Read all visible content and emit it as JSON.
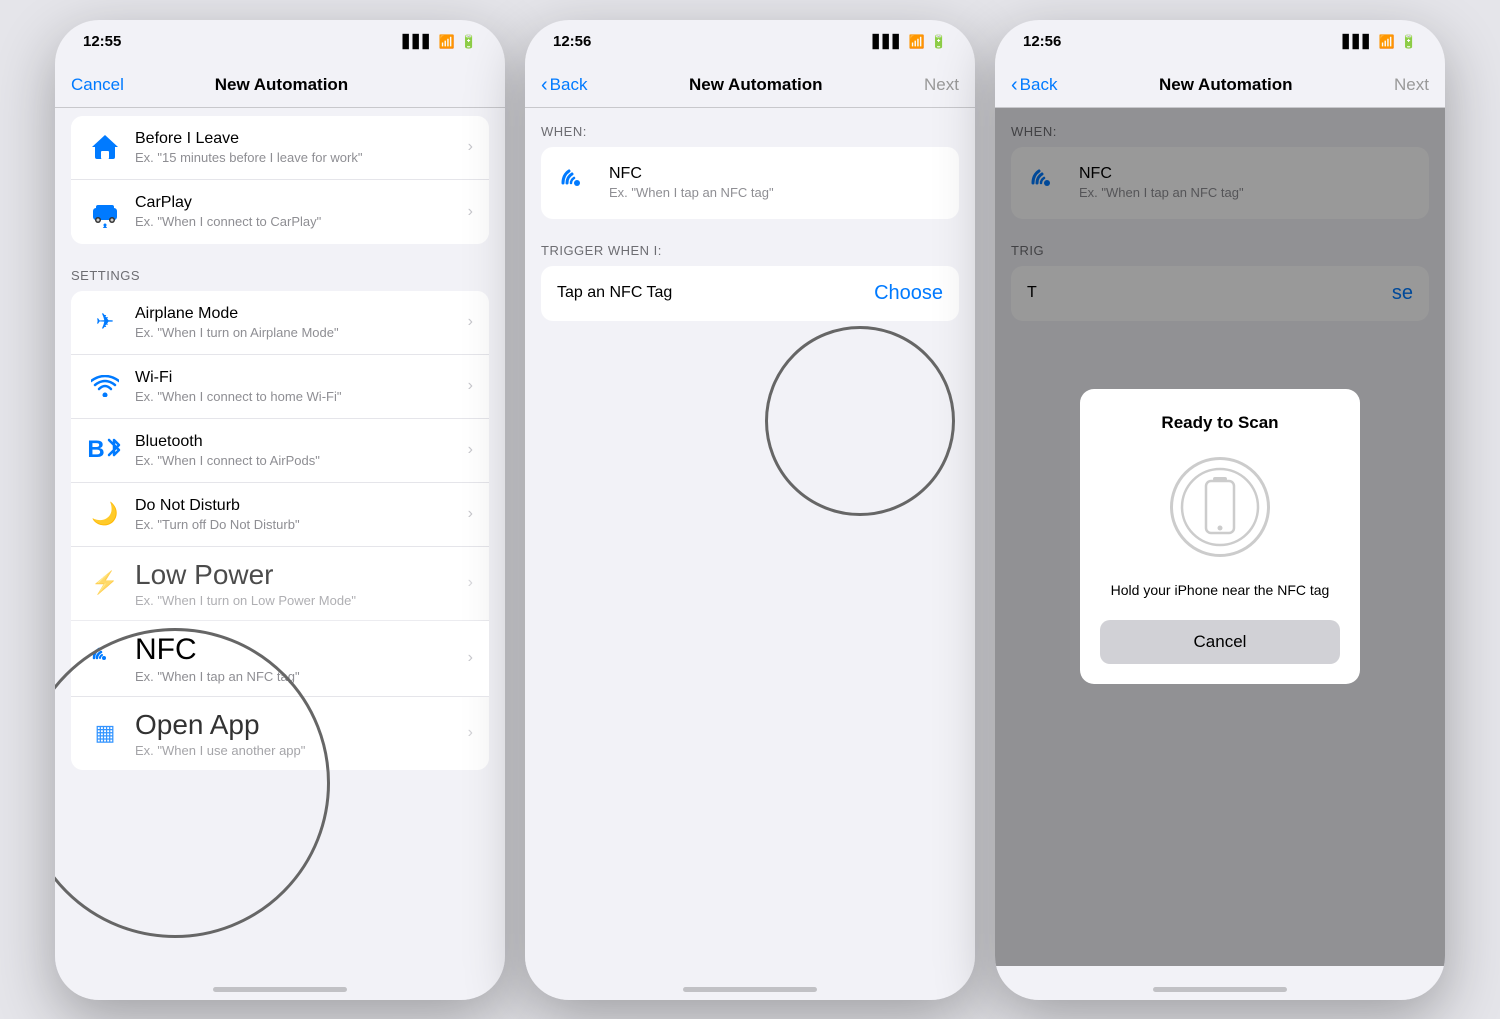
{
  "phone1": {
    "statusTime": "12:55",
    "navCancelLabel": "Cancel",
    "navTitleLabel": "New Automation",
    "items": [
      {
        "icon": "house",
        "title": "Before I Leave",
        "subtitle": "Ex. \"15 minutes before I leave for work\"",
        "category": "location"
      },
      {
        "icon": "car",
        "title": "CarPlay",
        "subtitle": "Ex. \"When I connect to CarPlay\"",
        "category": "carplay"
      }
    ],
    "settingsHeader": "SETTINGS",
    "settingsItems": [
      {
        "icon": "airplane",
        "title": "Airplane Mode",
        "subtitle": "Ex. \"When I turn on Airplane Mode\""
      },
      {
        "icon": "wifi",
        "title": "Wi-Fi",
        "subtitle": "Ex. \"When I connect to home Wi-Fi\""
      },
      {
        "icon": "bluetooth",
        "title": "Bluetooth",
        "subtitle": "Ex. \"When I connect to AirPods\""
      },
      {
        "icon": "moon",
        "title": "Do Not Disturb",
        "subtitle": "Ex. \"Turn off Do Not Disturb\""
      },
      {
        "icon": "lightning",
        "title": "Low Power",
        "subtitle": "Ex. \"When I turn on Low Power Mode\""
      },
      {
        "icon": "nfc",
        "title": "NFC",
        "subtitle": "Ex. \"When I tap an NFC tag\""
      },
      {
        "icon": "app",
        "title": "Open App",
        "subtitle": "Ex. \"Whe...\""
      }
    ]
  },
  "phone2": {
    "statusTime": "12:56",
    "navBackLabel": "Back",
    "navTitleLabel": "New Automation",
    "navNextLabel": "Next",
    "whenLabel": "WHEN:",
    "nfcTitle": "NFC",
    "nfcSubtitle": "Ex. \"When I tap an NFC tag\"",
    "triggerLabel": "TRIGGER WHEN I:",
    "triggerText": "Tap an NFC Tag",
    "chooseLabel": "Choose"
  },
  "phone3": {
    "statusTime": "12:56",
    "navBackLabel": "Back",
    "navTitleLabel": "New Automation",
    "navNextLabel": "Next",
    "whenLabel": "WHEN:",
    "nfcTitle": "NFC",
    "nfcSubtitle": "Ex. \"When I tap an NFC tag\"",
    "triggerLabel": "TRIG",
    "choosePartial": "se",
    "dialog": {
      "title": "Ready to Scan",
      "message": "Hold your iPhone near the NFC tag",
      "cancelLabel": "Cancel"
    }
  }
}
